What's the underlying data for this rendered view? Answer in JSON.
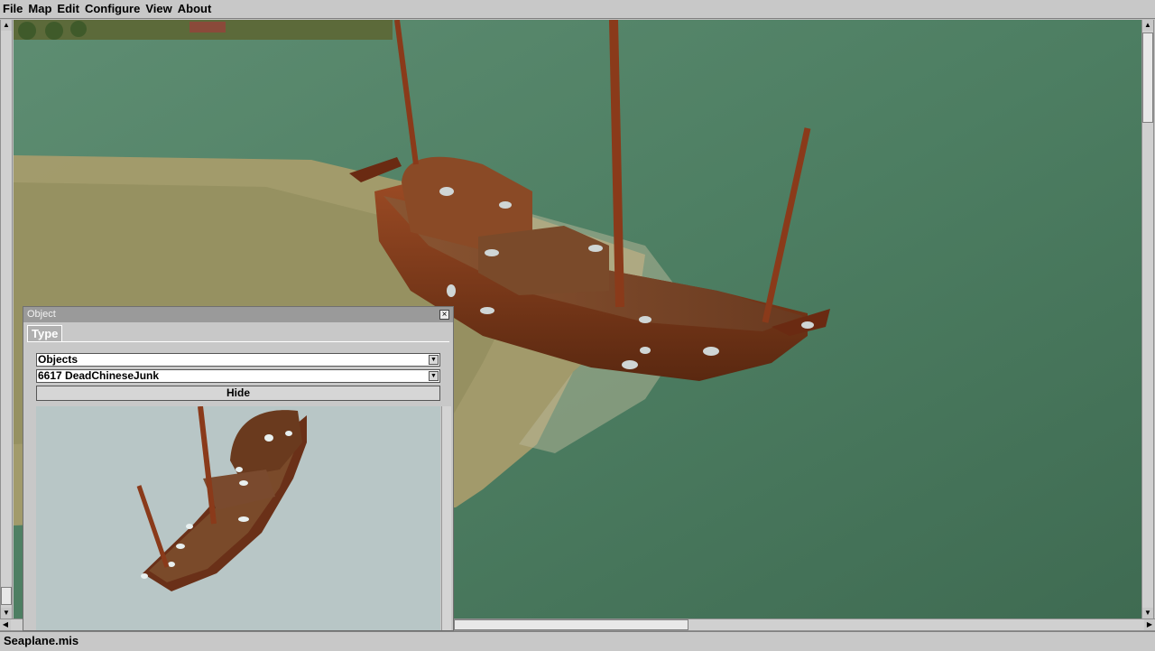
{
  "menu": {
    "items": [
      "File",
      "Map",
      "Edit",
      "Configure",
      "View",
      "About"
    ]
  },
  "object_panel": {
    "title": "Object",
    "close_glyph": "×",
    "tab_label": "Type",
    "category_value": "Objects",
    "object_value": "6617 DeadChineseJunk",
    "hide_label": "Hide"
  },
  "status": {
    "filename": "Seaplane.mis"
  },
  "icons": {
    "close": "close-icon",
    "dropdown": "chevron-down-icon",
    "scroll_up": "arrow-up-icon",
    "scroll_down": "arrow-down-icon",
    "scroll_left": "arrow-left-icon",
    "scroll_right": "arrow-right-icon"
  },
  "colors": {
    "water": "#4f7f63",
    "sand": "#a79c6c",
    "hull": "#7a3a1c",
    "mast": "#8a3a1a",
    "preview_bg": "#b8c6c6"
  }
}
